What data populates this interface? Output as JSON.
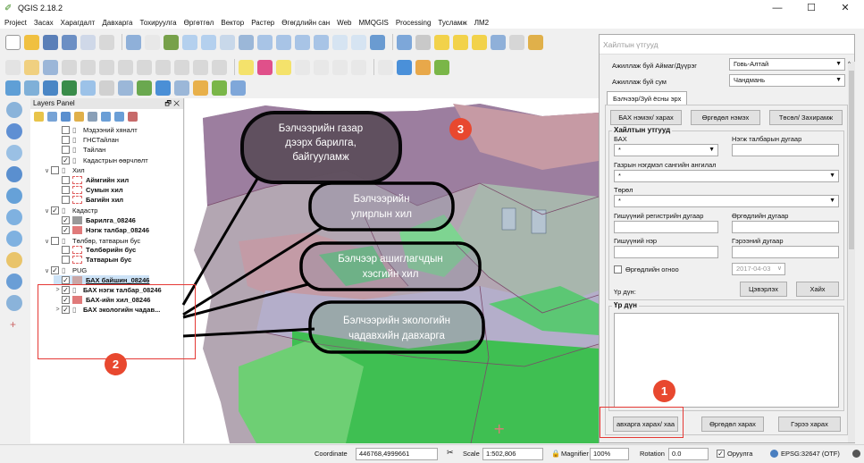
{
  "window": {
    "title": "QGIS 2.18.2",
    "minimize": "—",
    "maximize": "☐",
    "close": "✕"
  },
  "menu": [
    "Project",
    "Засах",
    "Харагдалт",
    "Давхарга",
    "Тохируулга",
    "Өргөтгөл",
    "Вектор",
    "Растер",
    "Өгөгдлийн сан",
    "Web",
    "MMQGIS",
    "Processing",
    "Тусламж",
    "ЛМ2"
  ],
  "layers_panel": {
    "title": "Layers Panel",
    "float_icon": "🗗",
    "close_icon": "✕",
    "items": [
      {
        "label": "Мэдээний хяналт",
        "level": 1,
        "expander": "",
        "checked": false,
        "kind": "group",
        "bold": false
      },
      {
        "label": "ГНСТайлан",
        "level": 1,
        "expander": "",
        "checked": false,
        "kind": "group",
        "bold": false
      },
      {
        "label": "Тайлан",
        "level": 1,
        "expander": "",
        "checked": false,
        "kind": "group",
        "bold": false
      },
      {
        "label": "Кадастрын өөрчлөлт",
        "level": 1,
        "expander": "",
        "checked": true,
        "kind": "group",
        "bold": false
      },
      {
        "label": "Хил",
        "level": 0,
        "expander": "∨",
        "checked": false,
        "kind": "group",
        "bold": false
      },
      {
        "label": "Аймгийн хил",
        "level": 1,
        "expander": "",
        "checked": false,
        "kind": "layer",
        "swatch": "#e06060",
        "bold": true
      },
      {
        "label": "Сумын хил",
        "level": 1,
        "expander": "",
        "checked": false,
        "kind": "layer",
        "swatch": "#e06060",
        "bold": true
      },
      {
        "label": "Багийн хил",
        "level": 1,
        "expander": "",
        "checked": false,
        "kind": "layer",
        "swatch": "#e06060",
        "bold": true
      },
      {
        "label": "Кадастр",
        "level": 0,
        "expander": "∨",
        "checked": true,
        "kind": "group",
        "bold": false
      },
      {
        "label": "Барилга_08246",
        "level": 1,
        "expander": "",
        "checked": true,
        "kind": "layer",
        "swatch": "#999999",
        "bold": true
      },
      {
        "label": "Нэгж талбар_08246",
        "level": 1,
        "expander": "",
        "checked": true,
        "kind": "layer",
        "swatch": "#e07a7a",
        "bold": true
      },
      {
        "label": "Төлбөр, татварын бус",
        "level": 0,
        "expander": "∨",
        "checked": false,
        "kind": "group",
        "bold": false
      },
      {
        "label": "Төлбөрийн бус",
        "level": 1,
        "expander": "",
        "checked": false,
        "kind": "layer",
        "swatch": "#e06060",
        "bold": true
      },
      {
        "label": "Татварын бус",
        "level": 1,
        "expander": "",
        "checked": false,
        "kind": "layer",
        "swatch": "#e06060",
        "bold": true
      },
      {
        "label": "PUG",
        "level": 0,
        "expander": "∨",
        "checked": true,
        "kind": "group",
        "bold": false
      },
      {
        "label": "БАХ байшин_08246",
        "level": 1,
        "expander": "",
        "checked": true,
        "kind": "layer",
        "swatch": "#c9a6a6",
        "bold": true,
        "selected": true
      },
      {
        "label": "БАХ нэгж талбар_08246",
        "level": 1,
        "expander": ">",
        "checked": true,
        "kind": "group-layer",
        "bold": true
      },
      {
        "label": "БАХ-ийн хил_08246",
        "level": 1,
        "expander": "",
        "checked": true,
        "kind": "layer",
        "swatch": "#e07a7a",
        "bold": true
      },
      {
        "label": "БАХ экологийн чадав...",
        "level": 1,
        "expander": ">",
        "checked": true,
        "kind": "group-layer",
        "bold": true
      }
    ]
  },
  "map": {
    "callouts": [
      "Бэлчээрийн газар дээрх барилга, байгууламж",
      "Бэлчээрийн улирлын хил",
      "Бэлчээр ашиглагчдын хэсгийн хил",
      "Бэлчээрийн экологийн чадавхийн давхарга"
    ],
    "plus_marker": "+"
  },
  "dialog": {
    "title": "Хайлтын үтгууд",
    "aimag_label": "Ажиллаж буй Аймаг/Дүүрэг",
    "aimag_value": "Говь-Алтай",
    "sum_label": "Ажиллаж буй сум",
    "sum_value": "Чандмань",
    "tab_label": "Бэлчээр/Зуй ёсны эрх",
    "btn_bah": "БАХ нэмэх/ харах",
    "btn_ugudul": "Өргөдөл нэмэх",
    "btn_tusul": "Төсөл/ Захирамж",
    "search_group_title": "Хайлтын утгууд",
    "bah_label": "БАХ",
    "bah_value": "*",
    "negj_label": "Нэгж талбарын дугаар",
    "land_class_label": "Газрын нэгдмэл сангийн ангилал",
    "land_class_value": "*",
    "torol_label": "Төрөл",
    "torol_value": "*",
    "reg_label": "Гишүүний регистрийн дугаар",
    "ugudul_no_label": "Өргөдлийн дугаар",
    "name_label": "Гишүүний нэр",
    "contract_label": "Гэрээний дугаар",
    "date_check_label": "Өргөдлийн огноо",
    "date_value": "2017-04-03",
    "result_label": "Үр дүн:",
    "btn_clear": "Цэвэрлэх",
    "btn_search": "Хайх",
    "result_group_title": "Үр дүн",
    "btn_layer": "авхарга харах/ хаа",
    "btn_ugudul_view": "Өргөдөл харах",
    "btn_contract": "Гэрээ харах"
  },
  "status": {
    "coord_label": "Coordinate",
    "coord_value": "446768,4999661",
    "scale_label": "Scale",
    "scale_value": "1:502,806",
    "magnifier_label": "Magnifier",
    "magnifier_value": "100%",
    "rotation_label": "Rotation",
    "rotation_value": "0.0",
    "render_label": "Оруулга",
    "crs_label": "EPSG:32647 (OTF)"
  },
  "annotations": {
    "badge1": "1",
    "badge2": "2",
    "badge3": "3"
  },
  "colors": {
    "annotation_red": "#e8482f",
    "map_green": "#3fbf52",
    "map_purple": "#9c7e9f"
  }
}
